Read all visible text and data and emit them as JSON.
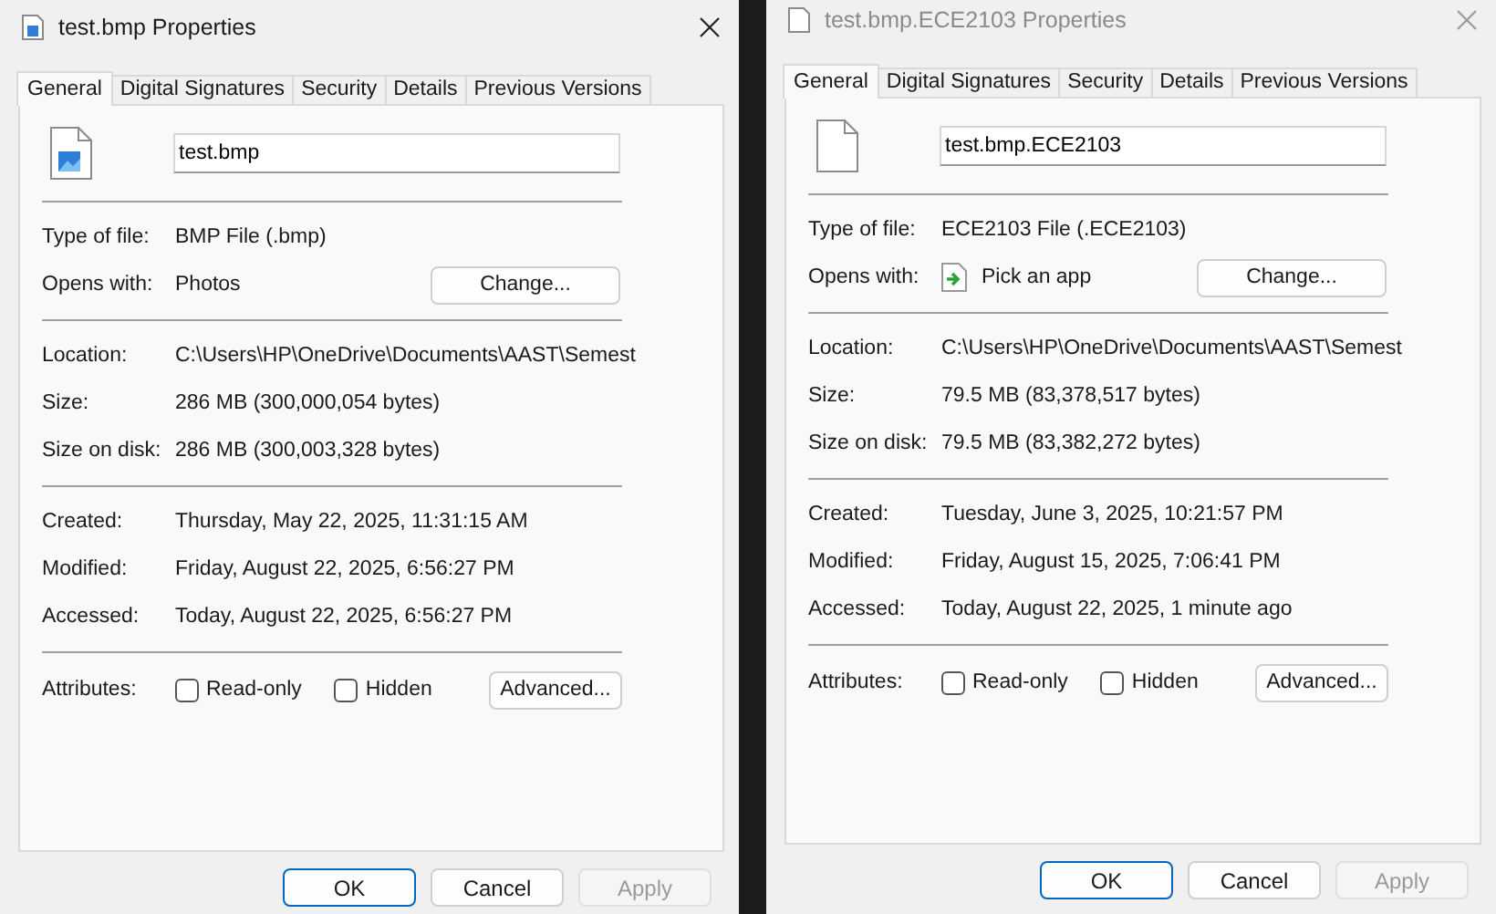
{
  "windows": [
    {
      "title": "test.bmp Properties",
      "active": true,
      "kind": "image",
      "tabs": [
        {
          "label": "General",
          "selected": true
        },
        {
          "label": "Digital Signatures",
          "selected": false
        },
        {
          "label": "Security",
          "selected": false
        },
        {
          "label": "Details",
          "selected": false
        },
        {
          "label": "Previous Versions",
          "selected": false
        }
      ],
      "file_name": "test.bmp",
      "sections": [
        [
          {
            "label": "Type of file:",
            "value": "BMP File (.bmp)"
          },
          {
            "label": "Opens with:",
            "value": "Photos",
            "button": "Change..."
          }
        ],
        [
          {
            "label": "Location:",
            "value": "C:\\Users\\HP\\OneDrive\\Documents\\AAST\\Semest"
          },
          {
            "label": "Size:",
            "value": "286 MB (300,000,054 bytes)"
          },
          {
            "label": "Size on disk:",
            "value": "286 MB (300,003,328 bytes)"
          }
        ],
        [
          {
            "label": "Created:",
            "value": "Thursday, May 22, 2025, 11:31:15 AM"
          },
          {
            "label": "Modified:",
            "value": "Friday, August 22, 2025, 6:56:27 PM"
          },
          {
            "label": "Accessed:",
            "value": "Today, August 22, 2025, 6:56:27 PM"
          }
        ]
      ],
      "attributes": {
        "label": "Attributes:",
        "checkboxes": [
          {
            "label": "Read-only",
            "checked": false
          },
          {
            "label": "Hidden",
            "checked": false
          }
        ],
        "button": "Advanced..."
      },
      "buttons": [
        {
          "label": "OK",
          "default": true,
          "disabled": false
        },
        {
          "label": "Cancel",
          "default": false,
          "disabled": false
        },
        {
          "label": "Apply",
          "default": false,
          "disabled": true
        }
      ]
    },
    {
      "title": "test.bmp.ECE2103 Properties",
      "active": false,
      "kind": "blank",
      "tabs": [
        {
          "label": "General",
          "selected": true
        },
        {
          "label": "Digital Signatures",
          "selected": false
        },
        {
          "label": "Security",
          "selected": false
        },
        {
          "label": "Details",
          "selected": false
        },
        {
          "label": "Previous Versions",
          "selected": false
        }
      ],
      "file_name": "test.bmp.ECE2103",
      "sections": [
        [
          {
            "label": "Type of file:",
            "value": "ECE2103 File (.ECE2103)"
          },
          {
            "label": "Opens with:",
            "value": "Pick an app",
            "app_icon": true,
            "button": "Change..."
          }
        ],
        [
          {
            "label": "Location:",
            "value": "C:\\Users\\HP\\OneDrive\\Documents\\AAST\\Semest"
          },
          {
            "label": "Size:",
            "value": "79.5 MB (83,378,517 bytes)"
          },
          {
            "label": "Size on disk:",
            "value": "79.5 MB (83,382,272 bytes)"
          }
        ],
        [
          {
            "label": "Created:",
            "value": "Tuesday, June 3, 2025, 10:21:57 PM"
          },
          {
            "label": "Modified:",
            "value": "Friday, August 15, 2025, 7:06:41 PM"
          },
          {
            "label": "Accessed:",
            "value": "Today, August 22, 2025, 1 minute ago"
          }
        ]
      ],
      "attributes": {
        "label": "Attributes:",
        "checkboxes": [
          {
            "label": "Read-only",
            "checked": false
          },
          {
            "label": "Hidden",
            "checked": false
          }
        ],
        "button": "Advanced..."
      },
      "buttons": [
        {
          "label": "OK",
          "default": true,
          "disabled": false
        },
        {
          "label": "Cancel",
          "default": false,
          "disabled": false
        },
        {
          "label": "Apply",
          "default": false,
          "disabled": true
        }
      ]
    }
  ]
}
